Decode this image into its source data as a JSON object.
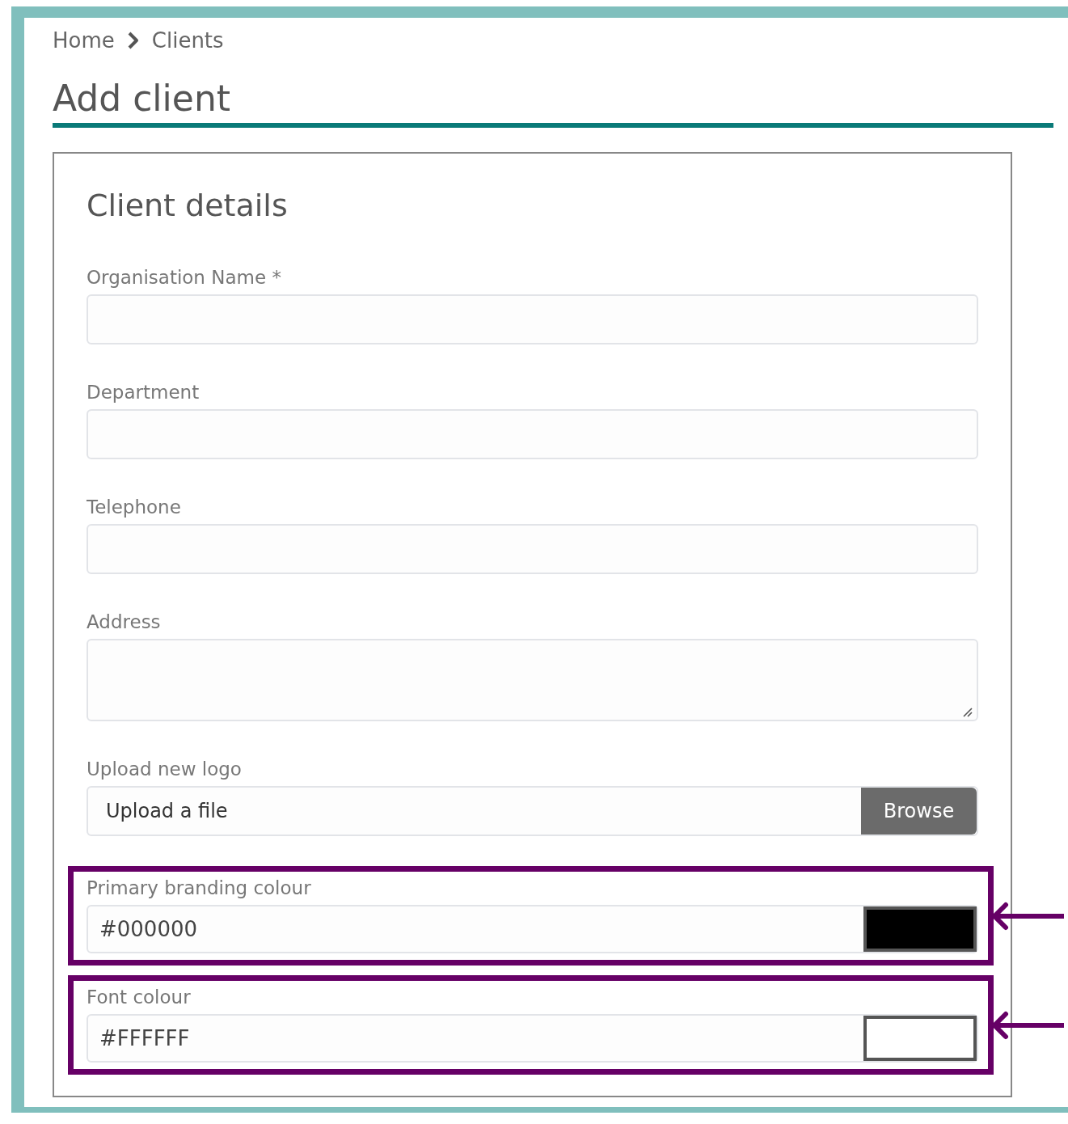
{
  "breadcrumb": [
    {
      "label": "Home"
    },
    {
      "label": "Clients"
    }
  ],
  "page_title": "Add client",
  "card": {
    "title": "Client details",
    "fields": [
      {
        "kind": "text",
        "label": "Organisation Name *",
        "highlighted": false
      },
      {
        "kind": "text",
        "label": "Department",
        "highlighted": false
      },
      {
        "kind": "text",
        "label": "Telephone",
        "highlighted": false
      },
      {
        "kind": "textarea",
        "label": "Address",
        "highlighted": false
      },
      {
        "kind": "file",
        "label": "Upload new logo",
        "text": "Upload a file",
        "button": "Browse",
        "highlighted": false
      },
      {
        "kind": "color",
        "label": "Primary branding colour",
        "value": "#000000",
        "color": "#000000",
        "highlighted": true
      },
      {
        "kind": "color",
        "label": "Font colour",
        "value": "#FFFFFF",
        "color": "#ffffff",
        "highlighted": true
      }
    ]
  }
}
